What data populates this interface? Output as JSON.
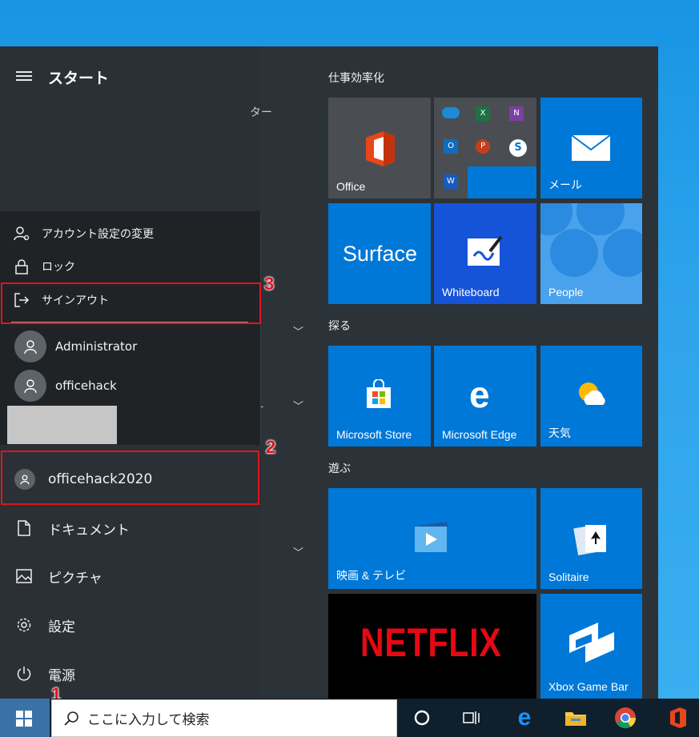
{
  "start": {
    "title": "スタート",
    "behind_text": "ター"
  },
  "account_menu": {
    "items": [
      {
        "label": "アカウント設定の変更",
        "icon": "account-settings-icon"
      },
      {
        "label": "ロック",
        "icon": "lock-icon"
      },
      {
        "label": "サインアウト",
        "icon": "sign-out-icon"
      }
    ],
    "users": [
      {
        "name": "Administrator"
      },
      {
        "name": "officehack"
      }
    ]
  },
  "current_user": {
    "name": "officehack2020"
  },
  "nav": [
    {
      "label": "ドキュメント",
      "icon": "document-icon"
    },
    {
      "label": "ピクチャ",
      "icon": "picture-icon"
    },
    {
      "label": "設定",
      "icon": "gear-icon"
    },
    {
      "label": "電源",
      "icon": "power-icon"
    }
  ],
  "annotations": {
    "one": "1",
    "two": "2",
    "three": "3"
  },
  "groups": {
    "productivity": "仕事効率化",
    "explore": "探る",
    "play": "遊ぶ"
  },
  "tiles": {
    "office": "Office",
    "mail": "メール",
    "surface": "Surface",
    "whiteboard": "Whiteboard",
    "people": "People",
    "store": "Microsoft Store",
    "edge": "Microsoft Edge",
    "weather": "天気",
    "movies": "映画 & テレビ",
    "solitaire": "Solitaire",
    "netflix": "NETFLIX",
    "xbox": "Xbox Game Bar"
  },
  "taskbar": {
    "search_placeholder": "ここに入力して検索"
  },
  "colors": {
    "tile_blue": "#0078d7",
    "annotation_red": "#e0141d",
    "netflix_red": "#e50914"
  }
}
